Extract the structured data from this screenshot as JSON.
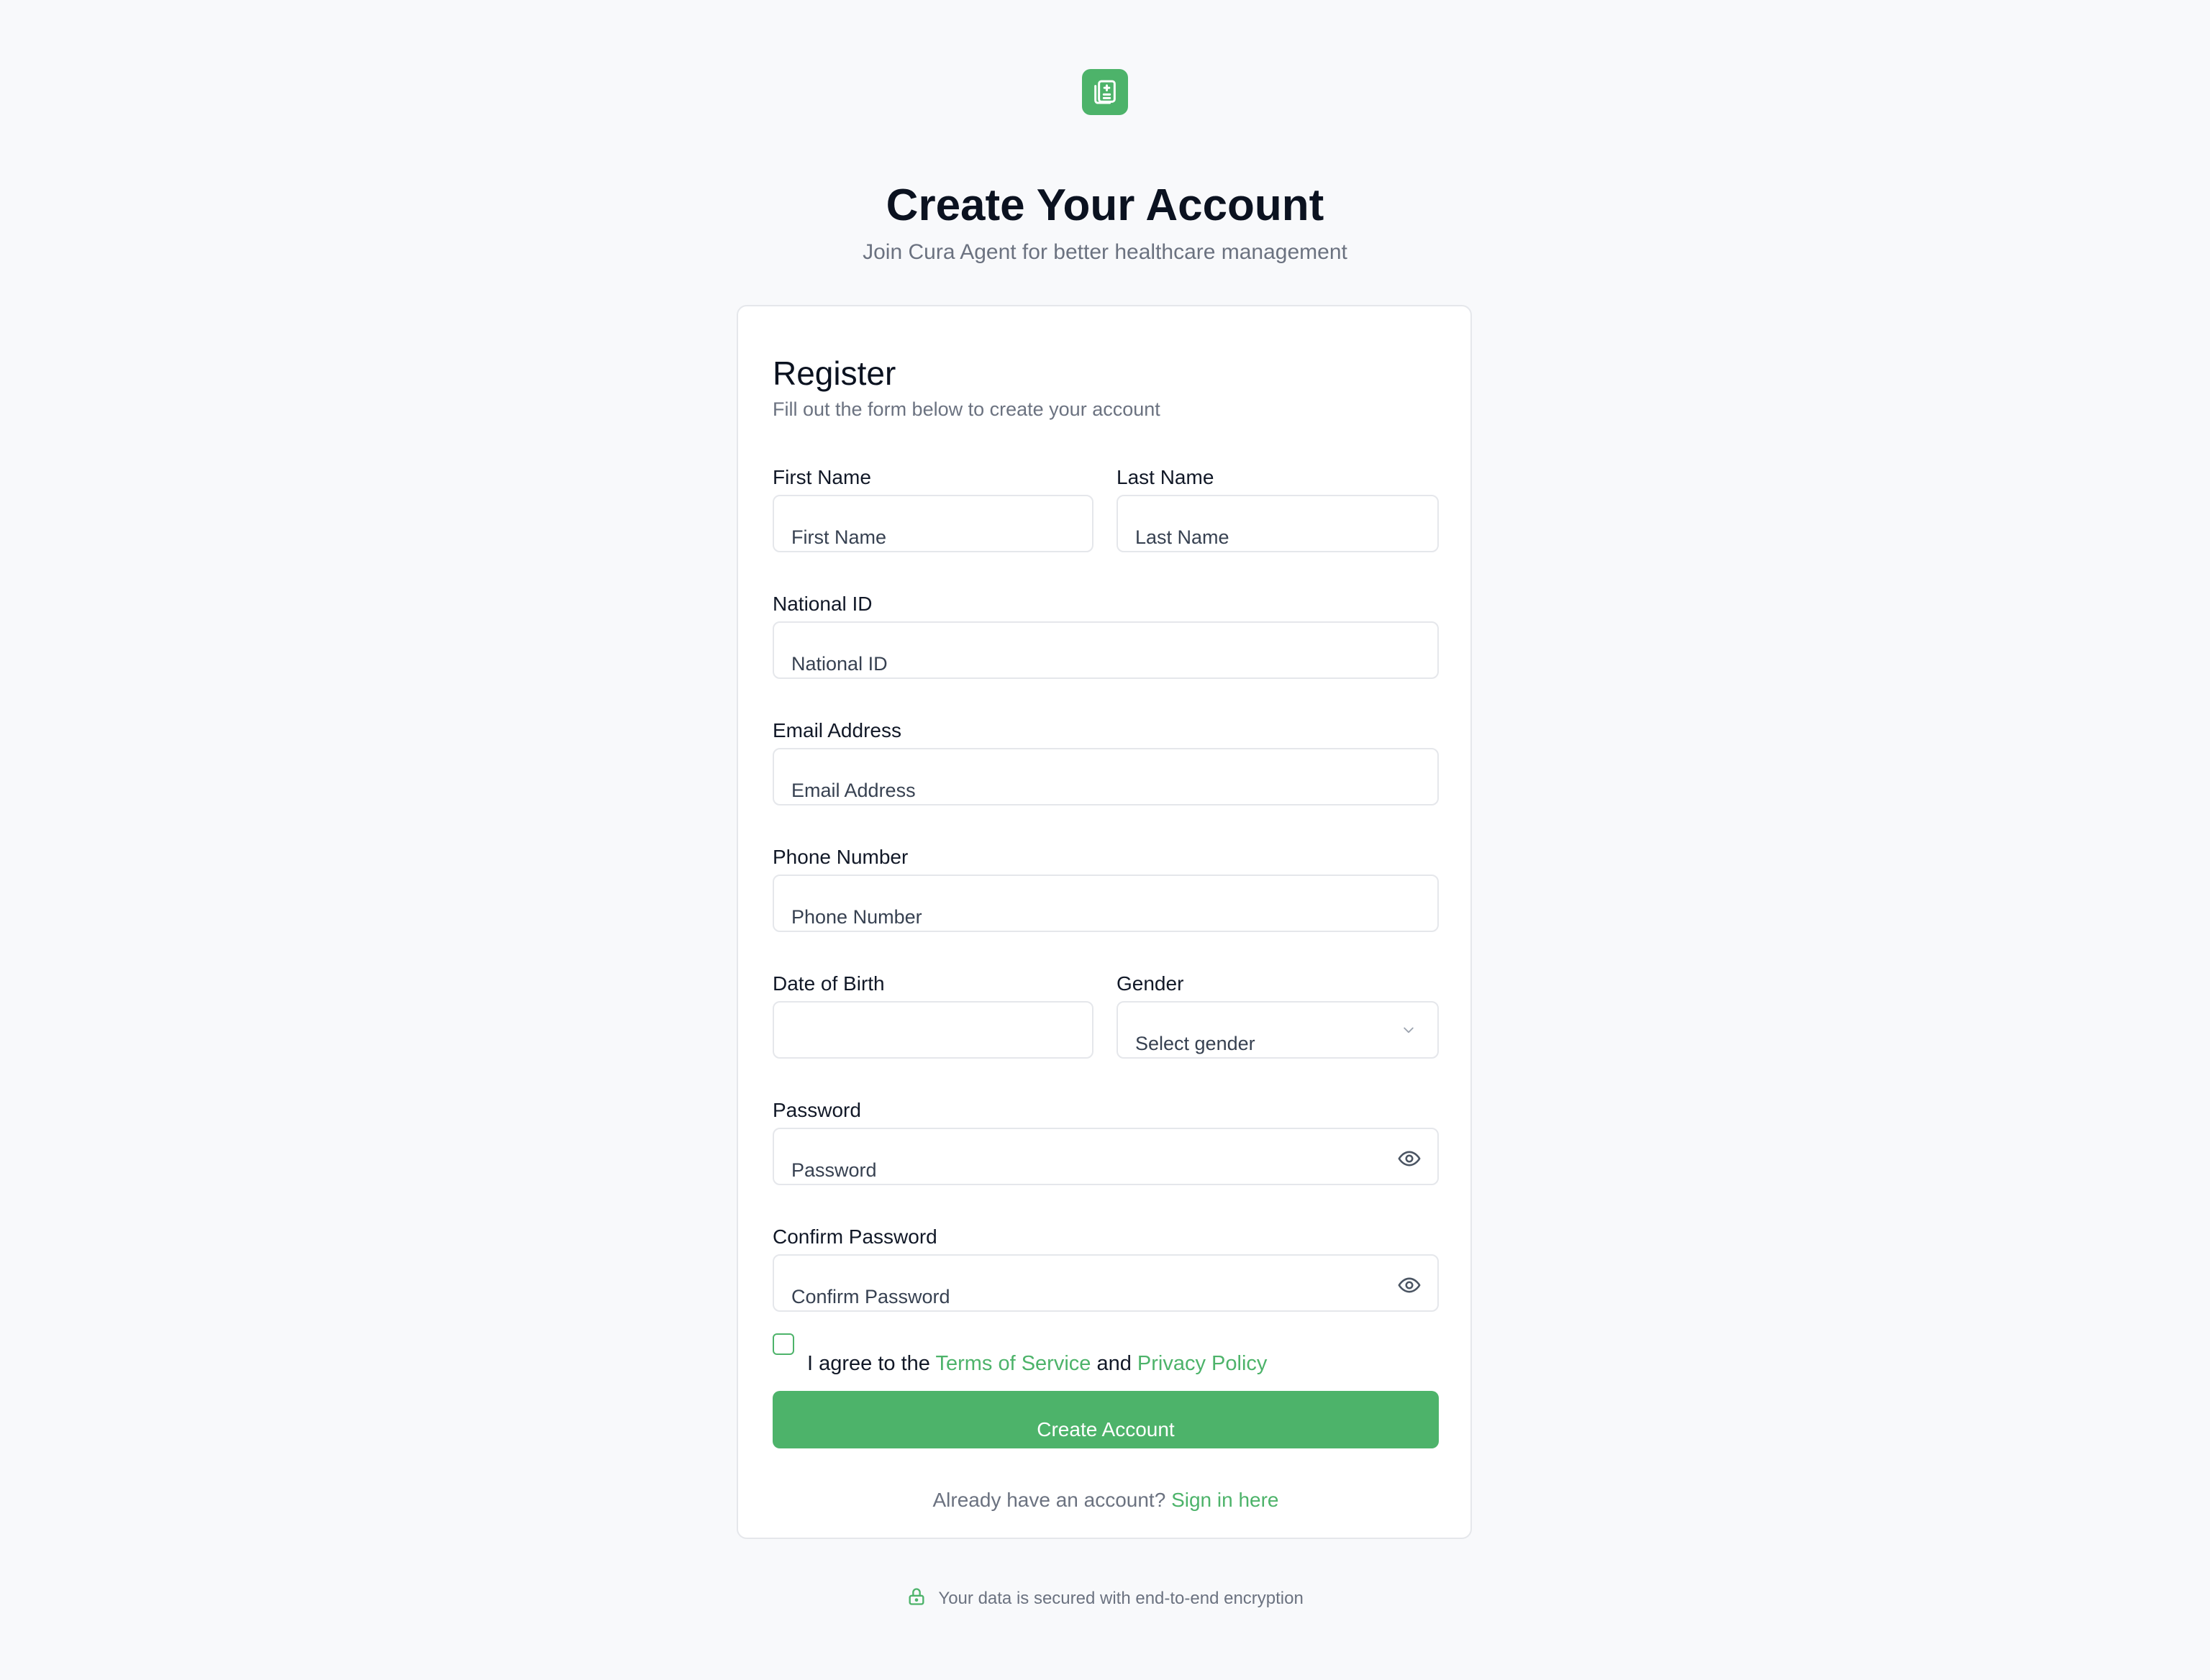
{
  "brand": {
    "color": "#4db36a"
  },
  "header": {
    "title": "Create Your Account",
    "subtitle": "Join Cura Agent for better healthcare management"
  },
  "card": {
    "title": "Register",
    "subtitle": "Fill out the form below to create your account"
  },
  "form": {
    "first_name": {
      "label": "First Name",
      "placeholder": "First Name"
    },
    "last_name": {
      "label": "Last Name",
      "placeholder": "Last Name"
    },
    "national_id": {
      "label": "National ID",
      "placeholder": "National ID"
    },
    "email": {
      "label": "Email Address",
      "placeholder": "Email Address"
    },
    "phone": {
      "label": "Phone Number",
      "placeholder": "Phone Number"
    },
    "dob": {
      "label": "Date of Birth",
      "value": ""
    },
    "gender": {
      "label": "Gender",
      "placeholder": "Select gender",
      "icon": "chevron-down-icon"
    },
    "password": {
      "label": "Password",
      "placeholder": "Password",
      "icon": "eye-icon"
    },
    "confirm_password": {
      "label": "Confirm Password",
      "placeholder": "Confirm Password",
      "icon": "eye-icon"
    },
    "agree": {
      "prefix": "I agree to the",
      "terms": "Terms of Service",
      "and": "and",
      "privacy": "Privacy Policy",
      "checked": false
    },
    "submit_label": "Create Account"
  },
  "signin": {
    "prompt": "Already have an account?",
    "link": "Sign in here"
  },
  "footer": {
    "text": "Your data is secured with end-to-end encryption",
    "icon": "lock-icon"
  }
}
